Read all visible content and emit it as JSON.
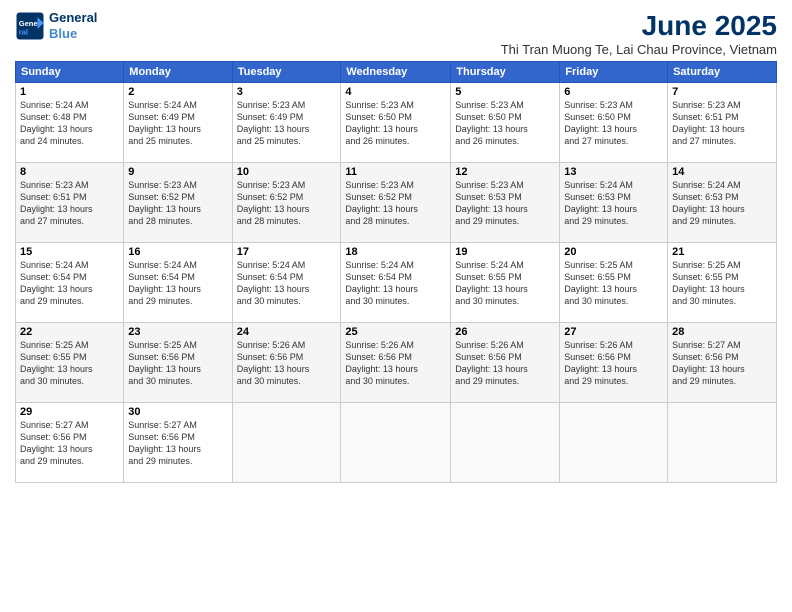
{
  "header": {
    "logo_line1": "General",
    "logo_line2": "Blue",
    "title": "June 2025",
    "subtitle": "Thi Tran Muong Te, Lai Chau Province, Vietnam"
  },
  "days_of_week": [
    "Sunday",
    "Monday",
    "Tuesday",
    "Wednesday",
    "Thursday",
    "Friday",
    "Saturday"
  ],
  "weeks": [
    [
      {
        "day": "1",
        "info": "Sunrise: 5:24 AM\nSunset: 6:48 PM\nDaylight: 13 hours\nand 24 minutes."
      },
      {
        "day": "2",
        "info": "Sunrise: 5:24 AM\nSunset: 6:49 PM\nDaylight: 13 hours\nand 25 minutes."
      },
      {
        "day": "3",
        "info": "Sunrise: 5:23 AM\nSunset: 6:49 PM\nDaylight: 13 hours\nand 25 minutes."
      },
      {
        "day": "4",
        "info": "Sunrise: 5:23 AM\nSunset: 6:50 PM\nDaylight: 13 hours\nand 26 minutes."
      },
      {
        "day": "5",
        "info": "Sunrise: 5:23 AM\nSunset: 6:50 PM\nDaylight: 13 hours\nand 26 minutes."
      },
      {
        "day": "6",
        "info": "Sunrise: 5:23 AM\nSunset: 6:50 PM\nDaylight: 13 hours\nand 27 minutes."
      },
      {
        "day": "7",
        "info": "Sunrise: 5:23 AM\nSunset: 6:51 PM\nDaylight: 13 hours\nand 27 minutes."
      }
    ],
    [
      {
        "day": "8",
        "info": "Sunrise: 5:23 AM\nSunset: 6:51 PM\nDaylight: 13 hours\nand 27 minutes."
      },
      {
        "day": "9",
        "info": "Sunrise: 5:23 AM\nSunset: 6:52 PM\nDaylight: 13 hours\nand 28 minutes."
      },
      {
        "day": "10",
        "info": "Sunrise: 5:23 AM\nSunset: 6:52 PM\nDaylight: 13 hours\nand 28 minutes."
      },
      {
        "day": "11",
        "info": "Sunrise: 5:23 AM\nSunset: 6:52 PM\nDaylight: 13 hours\nand 28 minutes."
      },
      {
        "day": "12",
        "info": "Sunrise: 5:23 AM\nSunset: 6:53 PM\nDaylight: 13 hours\nand 29 minutes."
      },
      {
        "day": "13",
        "info": "Sunrise: 5:24 AM\nSunset: 6:53 PM\nDaylight: 13 hours\nand 29 minutes."
      },
      {
        "day": "14",
        "info": "Sunrise: 5:24 AM\nSunset: 6:53 PM\nDaylight: 13 hours\nand 29 minutes."
      }
    ],
    [
      {
        "day": "15",
        "info": "Sunrise: 5:24 AM\nSunset: 6:54 PM\nDaylight: 13 hours\nand 29 minutes."
      },
      {
        "day": "16",
        "info": "Sunrise: 5:24 AM\nSunset: 6:54 PM\nDaylight: 13 hours\nand 29 minutes."
      },
      {
        "day": "17",
        "info": "Sunrise: 5:24 AM\nSunset: 6:54 PM\nDaylight: 13 hours\nand 30 minutes."
      },
      {
        "day": "18",
        "info": "Sunrise: 5:24 AM\nSunset: 6:54 PM\nDaylight: 13 hours\nand 30 minutes."
      },
      {
        "day": "19",
        "info": "Sunrise: 5:24 AM\nSunset: 6:55 PM\nDaylight: 13 hours\nand 30 minutes."
      },
      {
        "day": "20",
        "info": "Sunrise: 5:25 AM\nSunset: 6:55 PM\nDaylight: 13 hours\nand 30 minutes."
      },
      {
        "day": "21",
        "info": "Sunrise: 5:25 AM\nSunset: 6:55 PM\nDaylight: 13 hours\nand 30 minutes."
      }
    ],
    [
      {
        "day": "22",
        "info": "Sunrise: 5:25 AM\nSunset: 6:55 PM\nDaylight: 13 hours\nand 30 minutes."
      },
      {
        "day": "23",
        "info": "Sunrise: 5:25 AM\nSunset: 6:56 PM\nDaylight: 13 hours\nand 30 minutes."
      },
      {
        "day": "24",
        "info": "Sunrise: 5:26 AM\nSunset: 6:56 PM\nDaylight: 13 hours\nand 30 minutes."
      },
      {
        "day": "25",
        "info": "Sunrise: 5:26 AM\nSunset: 6:56 PM\nDaylight: 13 hours\nand 30 minutes."
      },
      {
        "day": "26",
        "info": "Sunrise: 5:26 AM\nSunset: 6:56 PM\nDaylight: 13 hours\nand 29 minutes."
      },
      {
        "day": "27",
        "info": "Sunrise: 5:26 AM\nSunset: 6:56 PM\nDaylight: 13 hours\nand 29 minutes."
      },
      {
        "day": "28",
        "info": "Sunrise: 5:27 AM\nSunset: 6:56 PM\nDaylight: 13 hours\nand 29 minutes."
      }
    ],
    [
      {
        "day": "29",
        "info": "Sunrise: 5:27 AM\nSunset: 6:56 PM\nDaylight: 13 hours\nand 29 minutes."
      },
      {
        "day": "30",
        "info": "Sunrise: 5:27 AM\nSunset: 6:56 PM\nDaylight: 13 hours\nand 29 minutes."
      },
      {
        "day": "",
        "info": ""
      },
      {
        "day": "",
        "info": ""
      },
      {
        "day": "",
        "info": ""
      },
      {
        "day": "",
        "info": ""
      },
      {
        "day": "",
        "info": ""
      }
    ]
  ]
}
